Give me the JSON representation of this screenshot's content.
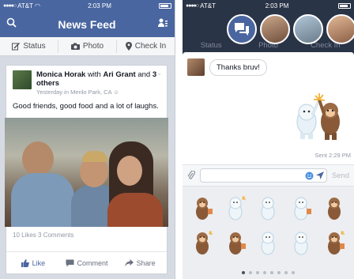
{
  "left": {
    "status": {
      "carrier": "AT&T",
      "time": "2:03 PM"
    },
    "nav": {
      "title": "News Feed",
      "search_icon": "search-icon",
      "friends_icon": "friend-requests-icon"
    },
    "composer_actions": [
      {
        "label": "Status",
        "icon": "status-edit-icon"
      },
      {
        "label": "Photo",
        "icon": "camera-icon"
      },
      {
        "label": "Check In",
        "icon": "location-pin-icon"
      }
    ],
    "post": {
      "author": "Monica Horak",
      "with_word": "with",
      "tagged": "Ari Grant",
      "and_word": "and",
      "others": "3 others",
      "meta": "Yesterday in Menlo Park, CA",
      "text": "Good friends, good food and a lot of laughs.",
      "counts": "10 Likes  3 Comments",
      "actions": [
        {
          "label": "Like",
          "icon": "thumbs-up-icon"
        },
        {
          "label": "Comment",
          "icon": "comment-icon"
        },
        {
          "label": "Share",
          "icon": "share-icon"
        }
      ]
    }
  },
  "right": {
    "status": {
      "carrier": "AT&T",
      "time": "2:03 PM"
    },
    "ghost_actions": [
      "Status",
      "Photo",
      "Check In"
    ],
    "message": "Thanks bruv!",
    "sent_label": "Sent 2:29 PM",
    "send_label": "Send",
    "pager": {
      "pages": 8,
      "active": 1
    }
  },
  "colors": {
    "facebook_blue": "#4a66a0",
    "dim_header": "#2a3447"
  }
}
